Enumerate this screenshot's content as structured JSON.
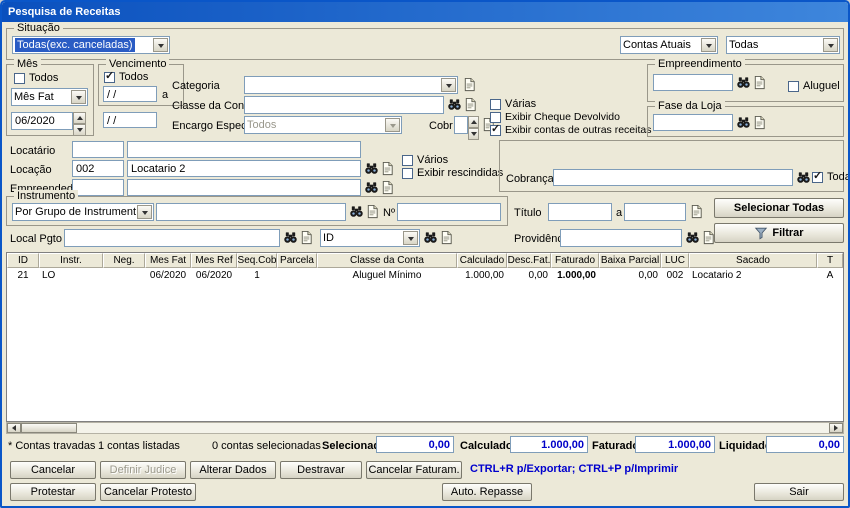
{
  "window": {
    "title": "Pesquisa de Receitas"
  },
  "colors": {
    "selection": "#2A5CC4",
    "value_text": "#0000C8",
    "titlebar_from": "#0A50BE",
    "titlebar_to": "#3E86DC"
  },
  "icons": {
    "binoculars-icon": "lookup search",
    "document-icon": "open list",
    "funnel-icon": "filter",
    "spinner-icon": "increment/decrement",
    "combo-arrow-icon": "dropdown"
  },
  "situacao": {
    "label": "Situação",
    "value": "Todas(exc. canceladas)",
    "contas_value": "Contas Atuais",
    "todas_value": "Todas"
  },
  "mes": {
    "label": "Mês",
    "todos_label": "Todos",
    "tipo_value": "Mês Fat",
    "periodo_value": "06/2020"
  },
  "vencimento": {
    "label": "Vencimento",
    "todos_label": "Todos",
    "de_value": "/ /",
    "a_label": "a",
    "ate_value": "/ /"
  },
  "categoria": {
    "label": "Categoria",
    "value": ""
  },
  "classe_conta": {
    "label": "Classe da Conta",
    "value": "",
    "varias_label": "Várias"
  },
  "encargo": {
    "label": "Encargo Espec.",
    "value": "Todos",
    "cobr_label": "Cobr",
    "cobr_value": ""
  },
  "exibir": {
    "cheque_label": "Exibir Cheque Devolvido",
    "outras_label": "Exibir contas de outras receitas"
  },
  "empreendimento": {
    "label": "Empreendimento",
    "value": "",
    "aluguel_label": "Aluguel"
  },
  "fase_loja": {
    "label": "Fase da Loja",
    "value": ""
  },
  "locatario": {
    "label": "Locatário",
    "codigo": "",
    "nome": ""
  },
  "locacao": {
    "label": "Locação",
    "codigo": "002",
    "nome": "Locatario 2",
    "varios_label": "Vários",
    "rescindidas_label": "Exibir rescindidas"
  },
  "empreendedor": {
    "label": "Empreendedor",
    "codigo": "",
    "nome": ""
  },
  "cobranca": {
    "label": "Cobrança",
    "value": "",
    "todas_label": "Todas"
  },
  "instrumento": {
    "label": "Instrumento",
    "grupo_value": "Por Grupo de Instrumento",
    "valor": "",
    "numero_label": "Nº",
    "numero_value": ""
  },
  "titulo": {
    "label": "Título",
    "de_value": "",
    "a_label": "a",
    "ate_value": ""
  },
  "local_pgto": {
    "label": "Local Pgto",
    "value": "",
    "id_value": "ID"
  },
  "providencia": {
    "label": "Providência",
    "value": ""
  },
  "actions": {
    "selecionar_todas": "Selecionar Todas",
    "filtrar": "Filtrar"
  },
  "grid": {
    "columns": [
      "ID",
      "Instr.",
      "Neg.",
      "Mes Fat",
      "Mes Ref",
      "Seq.Cob",
      "Parcela",
      "Classe da Conta",
      "Calculado",
      "Desc.Fat.",
      "Faturado",
      "Baixa Parcial",
      "LUC",
      "Sacado",
      "T"
    ],
    "rows": [
      [
        "21",
        "LO",
        "",
        "06/2020",
        "06/2020",
        "1",
        "",
        "Aluguel Mínimo",
        "1.000,00",
        "0,00",
        "1.000,00",
        "0,00",
        "002",
        "Locatario 2",
        "A"
      ]
    ]
  },
  "status": {
    "travadas": "* Contas travadas",
    "listadas": "1 contas listadas",
    "selecionadas": "0 contas selecionadas",
    "selecionado_label": "Selecionado",
    "selecionado_value": "0,00",
    "calculado_label": "Calculado",
    "calculado_value": "1.000,00",
    "faturado_label": "Faturado",
    "faturado_value": "1.000,00",
    "liquidado_label": "Liquidado",
    "liquidado_value": "0,00"
  },
  "buttons": {
    "cancelar": "Cancelar",
    "definir_judice": "Definir Judice",
    "alterar_dados": "Alterar Dados",
    "destravar": "Destravar",
    "cancelar_faturam": "Cancelar Faturam.",
    "hint": "CTRL+R p/Exportar; CTRL+P p/Imprimir",
    "protestar": "Protestar",
    "cancelar_protesto": "Cancelar Protesto",
    "auto_repasse": "Auto. Repasse",
    "sair": "Sair"
  }
}
